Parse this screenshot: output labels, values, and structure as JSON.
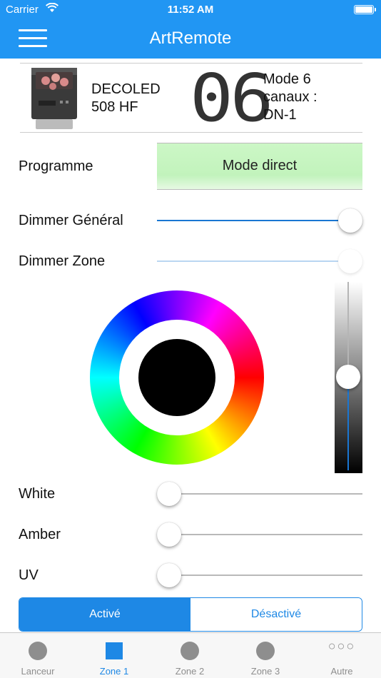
{
  "status": {
    "carrier": "Carrier",
    "time": "11:52 AM"
  },
  "nav": {
    "title": "ArtRemote"
  },
  "device": {
    "name": "DECOLED\n508 HF",
    "channel_display": "06",
    "mode": "Mode 6\ncanaux :\nDN-1"
  },
  "programme": {
    "label": "Programme",
    "value": "Mode direct"
  },
  "sliders": {
    "dimmer_general": {
      "label": "Dimmer Général",
      "level": 1.0
    },
    "dimmer_zone": {
      "label": "Dimmer Zone",
      "level": 1.0
    },
    "brightness": {
      "level": 0.5
    },
    "white": {
      "label": "White",
      "level": 0.0
    },
    "amber": {
      "label": "Amber",
      "level": 0.0
    },
    "uv": {
      "label": "UV",
      "level": 0.0
    }
  },
  "color": {
    "selected": "#000000"
  },
  "segment": {
    "active": "Activé",
    "inactive": "Désactivé"
  },
  "tabs": [
    {
      "label": "Lanceur",
      "icon": "circle-icon"
    },
    {
      "label": "Zone 1",
      "icon": "square-icon"
    },
    {
      "label": "Zone 2",
      "icon": "circle-icon"
    },
    {
      "label": "Zone 3",
      "icon": "circle-icon"
    },
    {
      "label": "Autre",
      "icon": "more-icon"
    }
  ],
  "colors": {
    "accent": "#2196f3",
    "programme_bg": "#c6f5c0"
  }
}
